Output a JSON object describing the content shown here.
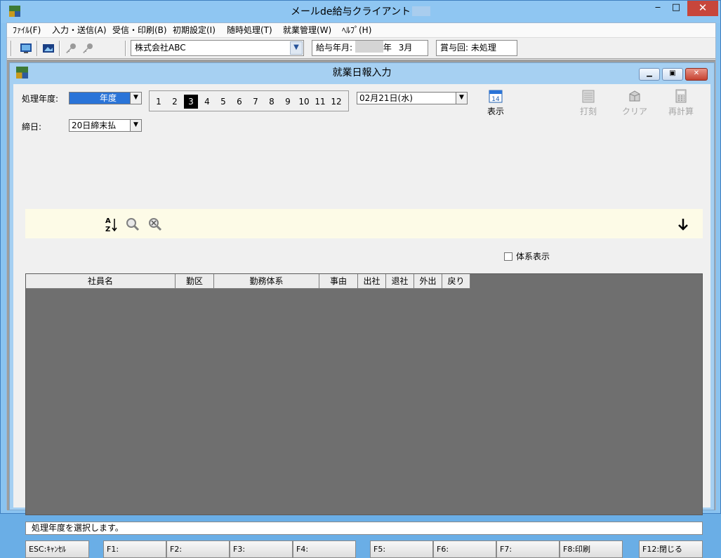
{
  "app": {
    "title": "メールde給与クライアント"
  },
  "menu": {
    "items": [
      "ﾌｧｲﾙ(F)",
      "入力・送信(A)",
      "受信・印刷(B)",
      "初期設定(I)",
      "随時処理(T)",
      "就業管理(W)",
      "ﾍﾙﾌﾟ(H)"
    ]
  },
  "toolbar": {
    "company": "株式会社ABC",
    "pay_period_label": "給与年月:",
    "pay_period_year_suffix": "年",
    "pay_period_month": "3月",
    "bonus_label": "賞与回:",
    "bonus_value": "未処理"
  },
  "window": {
    "title": "就業日報入力"
  },
  "form": {
    "year_label": "処理年度:",
    "year_value": "年度",
    "months": [
      "1",
      "2",
      "3",
      "4",
      "5",
      "6",
      "7",
      "8",
      "9",
      "10",
      "11",
      "12"
    ],
    "selected_month": "3",
    "date_value": "02月21日(水)",
    "closing_label": "締日:",
    "closing_value": "20日締末払"
  },
  "actions": {
    "display": "表示",
    "stamp": "打刻",
    "clear": "クリア",
    "recalc": "再計算"
  },
  "checkbox": {
    "system_display": "体系表示",
    "checked": false
  },
  "grid": {
    "columns": [
      "社員名",
      "勤区",
      "勤務体系",
      "事由",
      "出社",
      "退社",
      "外出",
      "戻り"
    ]
  },
  "status": {
    "message": "処理年度を選択します。"
  },
  "fkeys": [
    "ESC:ｷｬﾝｾﾙ",
    "F1:",
    "F2:",
    "F3:",
    "F4:",
    "F5:",
    "F6:",
    "F7:",
    "F8:印刷",
    "F12:閉じる"
  ],
  "colors": {
    "title_bar": "#8fc6f2",
    "selection": "#2a74d8",
    "grid_bg": "#6f6f6f",
    "strip_bg": "#fdfbe7"
  }
}
